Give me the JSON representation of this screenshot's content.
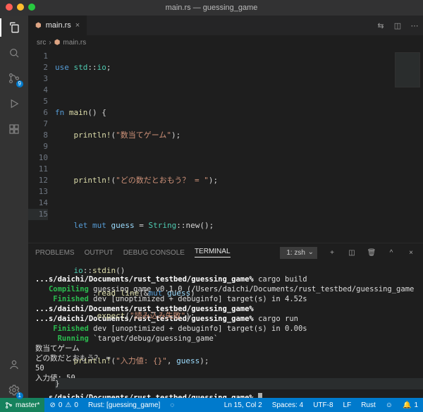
{
  "window": {
    "title": "main.rs — guessing_game"
  },
  "tab": {
    "label": "main.rs"
  },
  "breadcrumbs": {
    "folder": "src",
    "file": "main.rs"
  },
  "activity": {
    "scm_badge": "9"
  },
  "code": {
    "l1": {
      "kw1": "use",
      "path": "std",
      "sep": "::",
      "mod": "io",
      "semi": ";"
    },
    "l3": {
      "kw": "fn",
      "name": "main",
      "paren": "()",
      "brace": " {"
    },
    "l4": {
      "mac": "println!",
      "open": "(",
      "str": "\"数当てゲーム\"",
      "close": ");"
    },
    "l6": {
      "mac": "println!",
      "open": "(",
      "str": "\"どの数だとおもう？ = \"",
      "close": ");"
    },
    "l8": {
      "let": "let",
      "mut": "mut",
      "var": "guess",
      "eq": " = ",
      "ty": "String",
      "call": "::new()",
      "semi": ";"
    },
    "l10": {
      "obj": "io",
      "sep": "::",
      "fn": "stdin",
      "paren": "()"
    },
    "l11": {
      "dot": ".",
      "fn": "read_line",
      "open": "(",
      "amp": "&",
      "mut": "mut",
      "var": " guess",
      "close": ")"
    },
    "l12": {
      "dot": ".",
      "fn": "expect",
      "open": "(",
      "str": "\"読み込み失敗\"",
      "close": ");"
    },
    "l14": {
      "mac": "println!",
      "open": "(",
      "str": "\"入力値: {}\"",
      "comma": ", ",
      "var": "guess",
      "close": ");"
    },
    "l15": {
      "brace": "}"
    }
  },
  "panel": {
    "tabs": {
      "problems": "PROBLEMS",
      "output": "OUTPUT",
      "debug": "DEBUG CONSOLE",
      "terminal": "TERMINAL"
    },
    "shell": "1: zsh"
  },
  "terminal": {
    "p1": "...s/daichi/Documents/rust_testbed/guessing_game%",
    "c1": " cargo build",
    "comp_lbl": "   Compiling",
    "comp_txt": " guessing_game v0.1.0 (/Users/daichi/Documents/rust_testbed/guessing_game",
    "fin1_lbl": "    Finished",
    "fin1_txt": " dev [unoptimized + debuginfo] target(s) in 4.52s",
    "p2": "...s/daichi/Documents/rust_testbed/guessing_game%",
    "p3": "...s/daichi/Documents/rust_testbed/guessing_game%",
    "c3": " cargo run",
    "fin2_lbl": "    Finished",
    "fin2_txt": " dev [unoptimized + debuginfo] target(s) in 0.00s",
    "run_lbl": "     Running",
    "run_txt": " `target/debug/guessing_game`",
    "out1": "数当てゲーム",
    "out2": "どの数だとおもう？ = ",
    "out3": "50",
    "out4": "入力値: 50",
    "p4": "...s/daichi/Documents/rust_testbed/guessing_game% "
  },
  "status": {
    "branch": "master*",
    "errors": "0",
    "warnings": "0",
    "rust_analyzer": "Rust: [guessing_game]",
    "lncol": "Ln 15, Col 2",
    "spaces": "Spaces: 4",
    "enc": "UTF-8",
    "eol": "LF",
    "lang": "Rust",
    "bell": "1"
  }
}
